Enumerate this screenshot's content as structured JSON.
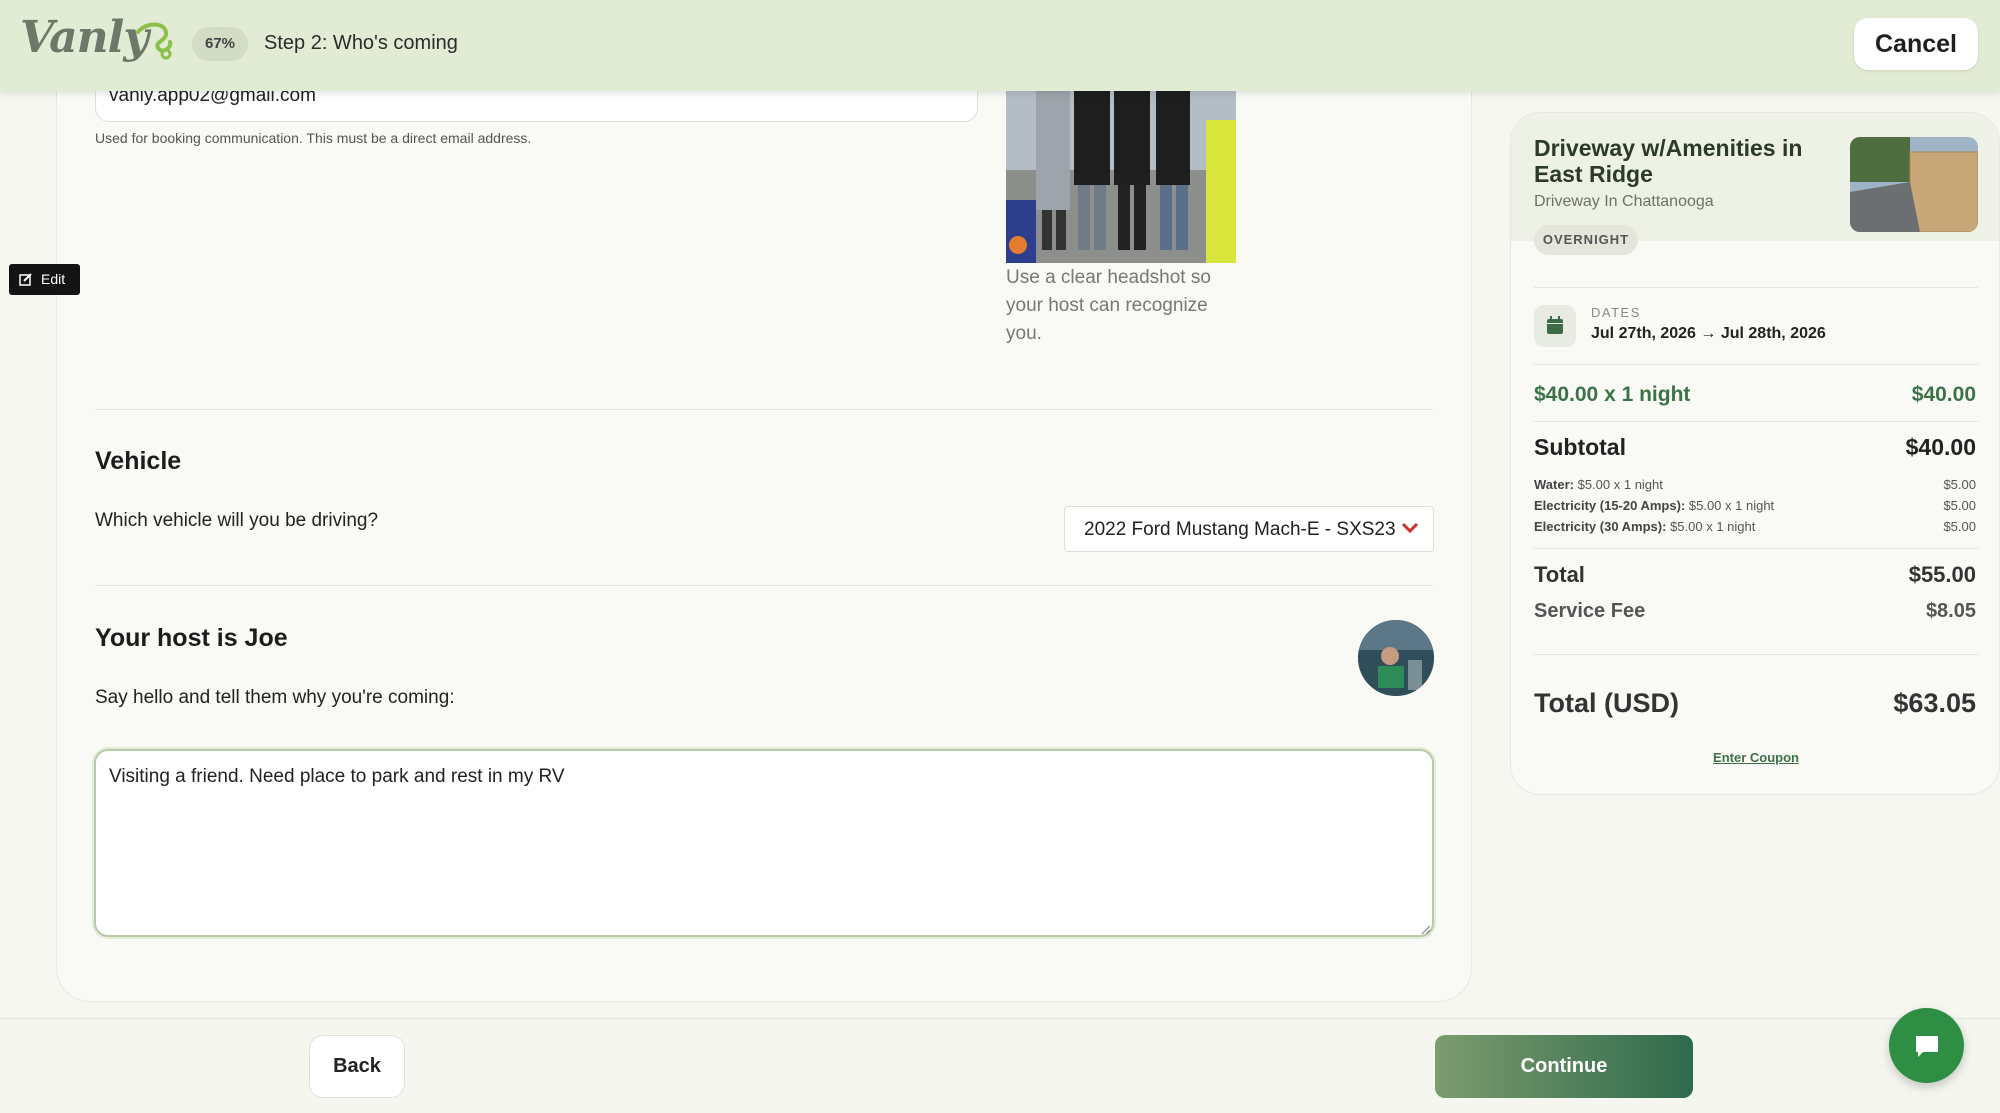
{
  "header": {
    "logo_text": "Vanly",
    "progress": "67%",
    "step": "Step 2: Who's coming",
    "cancel_label": "Cancel"
  },
  "contact": {
    "email_value": "vanly.app02@gmail.com",
    "email_help": "Used for booking communication. This must be a direct email address.",
    "photo_help": "Use a clear headshot so your host can recognize you."
  },
  "edit_label": "Edit",
  "vehicle": {
    "title": "Vehicle",
    "question": "Which vehicle will you be driving?",
    "selected": "2022 Ford Mustang Mach-E - SXS23"
  },
  "host": {
    "title": "Your host is Joe",
    "prompt": "Say hello and tell them why you're coming:",
    "message": "Visiting a friend. Need place to park and rest in my RV"
  },
  "summary": {
    "listing_title": "Driveway w/Amenities in East Ridge",
    "listing_sub": "Driveway In Chattanooga",
    "badge": "OVERNIGHT",
    "dates_label": "DATES",
    "dates_value": "Jul 27th, 2026 → Jul 28th, 2026",
    "nightly_label": "$40.00 x 1 night",
    "nightly_value": "$40.00",
    "subtotal_label": "Subtotal",
    "subtotal_value": "$40.00",
    "fees": [
      {
        "name": "Water:",
        "detail": "$5.00 x 1 night",
        "value": "$5.00"
      },
      {
        "name": "Electricity (15-20 Amps):",
        "detail": "$5.00 x 1 night",
        "value": "$5.00"
      },
      {
        "name": "Electricity (30 Amps):",
        "detail": "$5.00 x 1 night",
        "value": "$5.00"
      }
    ],
    "total_label": "Total",
    "total_value": "$55.00",
    "service_label": "Service Fee",
    "service_value": "$8.05",
    "grand_label": "Total (USD)",
    "grand_value": "$63.05",
    "coupon": "Enter Coupon"
  },
  "footer": {
    "back_label": "Back",
    "continue_label": "Continue"
  },
  "colors": {
    "brand_green": "#3c7247",
    "header_bg": "#e2ebd3",
    "chat_green": "#2e8e43"
  }
}
